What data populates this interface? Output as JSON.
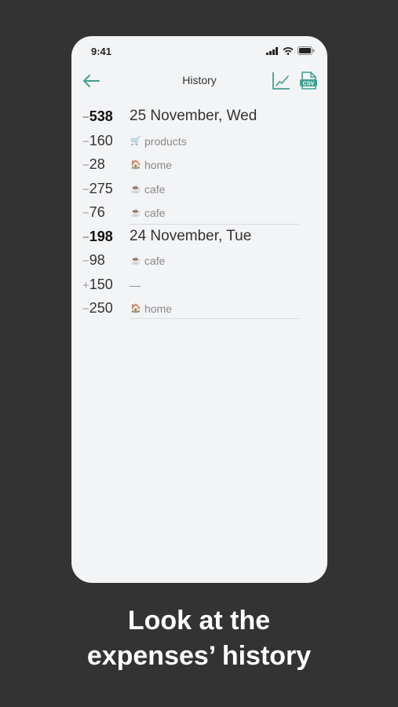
{
  "status_bar": {
    "time": "9:41"
  },
  "nav": {
    "title": "History"
  },
  "groups": [
    {
      "total": "538",
      "date": "25 November, Wed",
      "items": [
        {
          "sign": "−",
          "amount": "160",
          "icon": "🛒",
          "category": "products"
        },
        {
          "sign": "−",
          "amount": "28",
          "icon": "🏠",
          "category": "home"
        },
        {
          "sign": "−",
          "amount": "275",
          "icon": "☕",
          "category": "cafe"
        },
        {
          "sign": "−",
          "amount": "76",
          "icon": "☕",
          "category": "cafe"
        }
      ]
    },
    {
      "total": "198",
      "date": "24 November, Tue",
      "items": [
        {
          "sign": "−",
          "amount": "98",
          "icon": "☕",
          "category": "cafe"
        },
        {
          "sign": "+",
          "amount": "150",
          "icon": "",
          "category": "—"
        },
        {
          "sign": "−",
          "amount": "250",
          "icon": "🏠",
          "category": "home"
        }
      ]
    }
  ],
  "total_sign": "−",
  "caption": {
    "line1": "Look at the",
    "line2": "expenses’ history"
  },
  "colors": {
    "accent": "#3fa08f",
    "background": "#333333",
    "screen": "#f3f4f6"
  }
}
